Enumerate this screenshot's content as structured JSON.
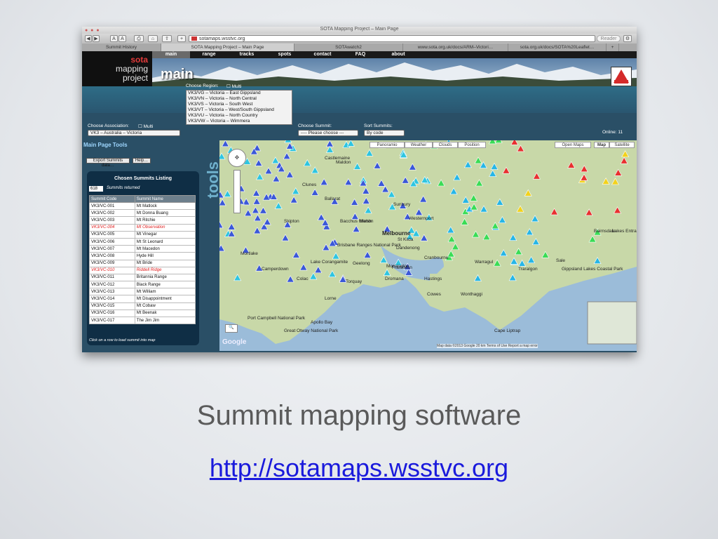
{
  "browser": {
    "window_title": "SOTA Mapping Project – Main Page",
    "url": "sotamaps.wsstvc.org",
    "reader_label": "Reader",
    "toolbar_buttons": [
      "◀",
      "▶",
      "A",
      "A",
      "⎙",
      "⌂",
      "⇪",
      "+"
    ],
    "tabs": [
      "Summit History",
      "SOTA Mapping Project – Main Page",
      "SOTAwatch2",
      "www.sota.org.uk/docs/ARM–Victori…",
      "sota.org.uk/docs/SOTA%20Leaflet…"
    ],
    "active_tab_index": 1
  },
  "site": {
    "logo": {
      "line1": "sota",
      "line2": "mapping",
      "line3": "project"
    },
    "page_word": "main",
    "nav": [
      "main",
      "range",
      "tracks",
      "spots",
      "contact",
      "FAQ",
      "about"
    ],
    "active_nav_index": 0,
    "region": {
      "label": "Choose Region:",
      "multi_label": "Multi",
      "options": [
        "VK3/VG – Victoria – East Gippsland",
        "VK3/VN – Victoria – North Central",
        "VK3/VS – Victoria – South West",
        "VK3/VT – Victoria – West/South Gippsland",
        "VK3/VU – Victoria – North Country",
        "VK3/VW – Victoria – Wimmera"
      ]
    },
    "association": {
      "label": "Choose Association:",
      "multi_label": "Multi",
      "value": "VK3 – Australia – Victoria"
    },
    "summit": {
      "label": "Choose Summit:",
      "value": "---- Please choose ---"
    },
    "sort": {
      "label": "Sort Summits:",
      "value": "By code"
    },
    "online": "Online: 11",
    "tools": {
      "header": "Main Page Tools",
      "vertical_word": "tools",
      "export_button": "Export Summits data…",
      "help_button": "Help…",
      "listing_title": "Chosen Summits Listing",
      "count": "618",
      "returned_label": "Summits returned",
      "columns": [
        "Summit Code",
        "Summit Name"
      ],
      "rows": [
        {
          "code": "VK3/VC-001",
          "name": "Mt Matlock",
          "highlight": false
        },
        {
          "code": "VK3/VC-002",
          "name": "Mt Donna Buang",
          "highlight": false
        },
        {
          "code": "VK3/VC-003",
          "name": "Mt Ritchie",
          "highlight": false
        },
        {
          "code": "VK3/VC-004",
          "name": "Mt Observation",
          "highlight": true
        },
        {
          "code": "VK3/VC-005",
          "name": "Mt Vinegar",
          "highlight": false
        },
        {
          "code": "VK3/VC-006",
          "name": "Mt St Leonard",
          "highlight": false
        },
        {
          "code": "VK3/VC-007",
          "name": "Mt Macedon",
          "highlight": false
        },
        {
          "code": "VK3/VC-008",
          "name": "Hyde Hill",
          "highlight": false
        },
        {
          "code": "VK3/VC-009",
          "name": "Mt Bride",
          "highlight": false
        },
        {
          "code": "VK3/VC-010",
          "name": "Riddell Ridge",
          "highlight": true
        },
        {
          "code": "VK3/VC-011",
          "name": "Britannia Range",
          "highlight": false
        },
        {
          "code": "VK3/VC-012",
          "name": "Black Range",
          "highlight": false
        },
        {
          "code": "VK3/VC-013",
          "name": "Mt William",
          "highlight": false
        },
        {
          "code": "VK3/VC-014",
          "name": "Mt Disappointment",
          "highlight": false
        },
        {
          "code": "VK3/VC-015",
          "name": "Mt Cobaw",
          "highlight": false
        },
        {
          "code": "VK3/VC-016",
          "name": "Mt Beenak",
          "highlight": false
        },
        {
          "code": "VK3/VC-017",
          "name": "The Jim Jim",
          "highlight": false
        }
      ],
      "footer": "Click on a row to load summit into map"
    },
    "map": {
      "buttons": [
        "Panoramio",
        "Weather",
        "Clouds",
        "Position"
      ],
      "map_types": [
        "Open Maps",
        "Map",
        "Satellite"
      ],
      "google_label": "Google",
      "attribution": "Map data ©2013 Google   20 km   Terms of Use   Report a map error",
      "places": [
        {
          "name": "Melbourne",
          "big": true
        },
        {
          "name": "St Kilda"
        },
        {
          "name": "Dandenong"
        },
        {
          "name": "Geelong"
        },
        {
          "name": "Frankston"
        },
        {
          "name": "Ballarat"
        },
        {
          "name": "Bacchus Marsh"
        },
        {
          "name": "Melton"
        },
        {
          "name": "Sunbury"
        },
        {
          "name": "Castlemaine"
        },
        {
          "name": "Maldon"
        },
        {
          "name": "Clunes"
        },
        {
          "name": "Skipton"
        },
        {
          "name": "Mortlake"
        },
        {
          "name": "Camperdown"
        },
        {
          "name": "Colac"
        },
        {
          "name": "Torquay"
        },
        {
          "name": "Lorne"
        },
        {
          "name": "Apollo Bay"
        },
        {
          "name": "Mornington"
        },
        {
          "name": "Dromana"
        },
        {
          "name": "Hastings"
        },
        {
          "name": "Cowes"
        },
        {
          "name": "Wonthaggi"
        },
        {
          "name": "Cranbourne"
        },
        {
          "name": "Warragul"
        },
        {
          "name": "Traralgon"
        },
        {
          "name": "Sale"
        },
        {
          "name": "Bairnsdale"
        },
        {
          "name": "Lakes Entrance"
        },
        {
          "name": "Cape Liptrap"
        },
        {
          "name": "Port Campbell National Park"
        },
        {
          "name": "Great Otway National Park"
        },
        {
          "name": "Brisbane Ranges National Park"
        },
        {
          "name": "Westernport"
        },
        {
          "name": "Gippsland Lakes Coastal Park"
        },
        {
          "name": "Lake Corangamite"
        }
      ]
    }
  },
  "caption": "Summit mapping software",
  "link": "http://sotamaps.wsstvc.org",
  "colors": {
    "link": "#1a1adc",
    "caption": "#5a5a5a",
    "highlight_row": "#e02020"
  }
}
